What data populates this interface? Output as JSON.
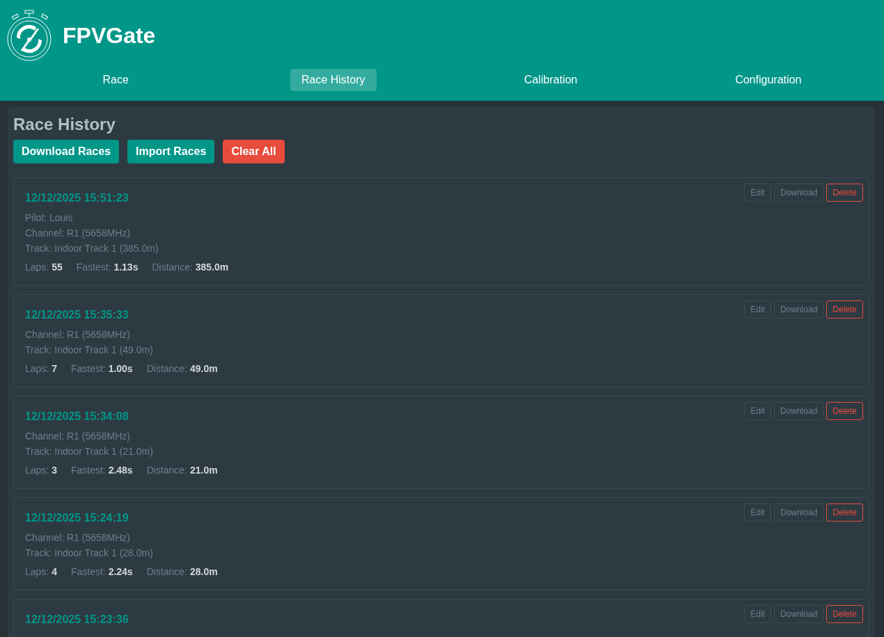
{
  "header": {
    "title": "FPVGate"
  },
  "tabs": [
    {
      "label": "Race",
      "selected": false
    },
    {
      "label": "Race History",
      "selected": true
    },
    {
      "label": "Calibration",
      "selected": false
    },
    {
      "label": "Configuration",
      "selected": false
    }
  ],
  "page": {
    "title": "Race History",
    "actions": [
      {
        "label": "Download Races",
        "kind": "primary"
      },
      {
        "label": "Import Races",
        "kind": "primary"
      },
      {
        "label": "Clear All",
        "kind": "danger"
      }
    ]
  },
  "races": [
    {
      "date": "12/12/2025 15:51:23",
      "details": [
        "Pilot: Louis",
        "Channel: R1 (5658MHz)",
        "Track: Indoor Track 1 (385.0m)"
      ],
      "stats": [
        {
          "label": "Laps:",
          "value": "55"
        },
        {
          "label": "Fastest:",
          "value": "1.13s"
        },
        {
          "label": "Distance:",
          "value": "385.0m"
        }
      ],
      "buttons": [
        {
          "label": "Edit",
          "kind": "plain"
        },
        {
          "label": "Download",
          "kind": "plain"
        },
        {
          "label": "Delete",
          "kind": "danger"
        }
      ]
    },
    {
      "date": "12/12/2025 15:35:33",
      "details": [
        "Channel: R1 (5658MHz)",
        "Track: Indoor Track 1 (49.0m)"
      ],
      "stats": [
        {
          "label": "Laps:",
          "value": "7"
        },
        {
          "label": "Fastest:",
          "value": "1.00s"
        },
        {
          "label": "Distance:",
          "value": "49.0m"
        }
      ],
      "buttons": [
        {
          "label": "Edit",
          "kind": "plain"
        },
        {
          "label": "Download",
          "kind": "plain"
        },
        {
          "label": "Delete",
          "kind": "danger"
        }
      ]
    },
    {
      "date": "12/12/2025 15:34:08",
      "details": [
        "Channel: R1 (5658MHz)",
        "Track: Indoor Track 1 (21.0m)"
      ],
      "stats": [
        {
          "label": "Laps:",
          "value": "3"
        },
        {
          "label": "Fastest:",
          "value": "2.48s"
        },
        {
          "label": "Distance:",
          "value": "21.0m"
        }
      ],
      "buttons": [
        {
          "label": "Edit",
          "kind": "plain"
        },
        {
          "label": "Download",
          "kind": "plain"
        },
        {
          "label": "Delete",
          "kind": "danger"
        }
      ]
    },
    {
      "date": "12/12/2025 15:24:19",
      "details": [
        "Channel: R1 (5658MHz)",
        "Track: Indoor Track 1 (28.0m)"
      ],
      "stats": [
        {
          "label": "Laps:",
          "value": "4"
        },
        {
          "label": "Fastest:",
          "value": "2.24s"
        },
        {
          "label": "Distance:",
          "value": "28.0m"
        }
      ],
      "buttons": [
        {
          "label": "Edit",
          "kind": "plain"
        },
        {
          "label": "Download",
          "kind": "plain"
        },
        {
          "label": "Delete",
          "kind": "danger"
        }
      ]
    },
    {
      "date": "12/12/2025 15:23:36",
      "buttons": [
        {
          "label": "Edit",
          "kind": "plain"
        },
        {
          "label": "Download",
          "kind": "plain"
        },
        {
          "label": "Delete",
          "kind": "danger"
        }
      ]
    }
  ]
}
